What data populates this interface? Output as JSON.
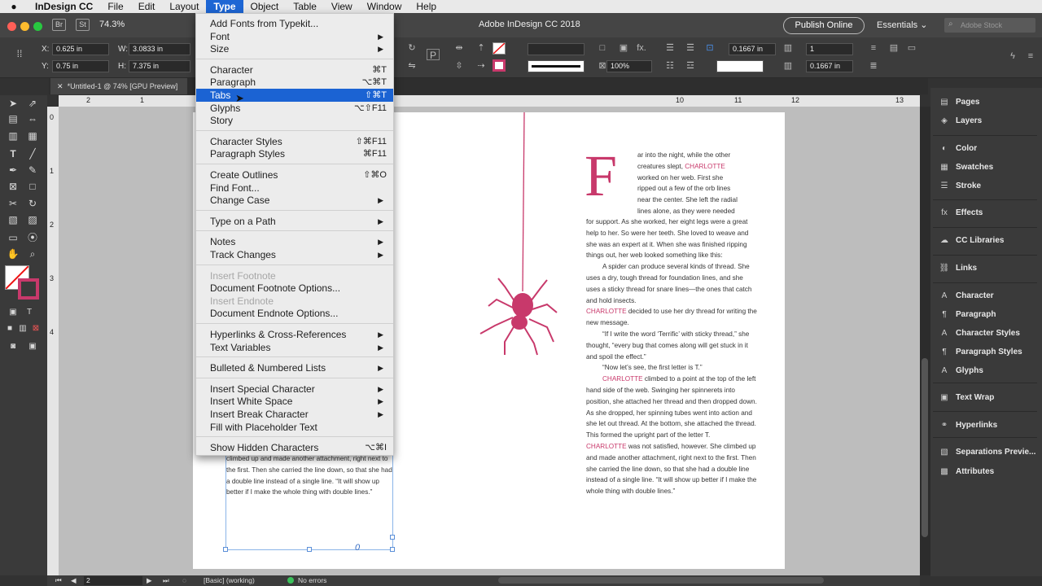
{
  "menubar": {
    "app": "InDesign CC",
    "items": [
      "File",
      "Edit",
      "Layout",
      "Type",
      "Object",
      "Table",
      "View",
      "Window",
      "Help"
    ]
  },
  "titlebar": {
    "zoom": "74.3%",
    "title": "Adobe InDesign CC 2018",
    "publish": "Publish Online",
    "workspace": "Essentials",
    "search_placeholder": "Adobe Stock",
    "app_icons": [
      "Br",
      "St"
    ]
  },
  "control": {
    "x_label": "X:",
    "x_value": "0.625 in",
    "y_label": "Y:",
    "y_value": "0.75 in",
    "w_label": "W:",
    "w_value": "3.0833 in",
    "h_label": "H:",
    "h_value": "7.375 in",
    "opacity": "100%",
    "offset1": "0.1667 in",
    "offset2": "0.1667 in",
    "columns": "1"
  },
  "doc_tab": "*Untitled-1 @ 74% [GPU Preview]",
  "ruler": {
    "h": [
      "2",
      "1",
      "10",
      "11",
      "12",
      "13"
    ],
    "v": [
      "0",
      "1",
      "2",
      "3",
      "4"
    ]
  },
  "type_menu": {
    "groups": [
      [
        {
          "label": "Add Fonts from Typekit...",
          "shortcut": "",
          "arrow": false,
          "disabled": false
        },
        {
          "label": "Font",
          "shortcut": "",
          "arrow": true,
          "disabled": false
        },
        {
          "label": "Size",
          "shortcut": "",
          "arrow": true,
          "disabled": false
        }
      ],
      [
        {
          "label": "Character",
          "shortcut": "⌘T",
          "arrow": false,
          "disabled": false
        },
        {
          "label": "Paragraph",
          "shortcut": "⌥⌘T",
          "arrow": false,
          "disabled": false
        },
        {
          "label": "Tabs",
          "shortcut": "⇧⌘T",
          "arrow": false,
          "disabled": false,
          "highlighted": true
        },
        {
          "label": "Glyphs",
          "shortcut": "⌥⇧F11",
          "arrow": false,
          "disabled": false
        },
        {
          "label": "Story",
          "shortcut": "",
          "arrow": false,
          "disabled": false
        }
      ],
      [
        {
          "label": "Character Styles",
          "shortcut": "⇧⌘F11",
          "arrow": false,
          "disabled": false
        },
        {
          "label": "Paragraph Styles",
          "shortcut": "⌘F11",
          "arrow": false,
          "disabled": false
        }
      ],
      [
        {
          "label": "Create Outlines",
          "shortcut": "⇧⌘O",
          "arrow": false,
          "disabled": false
        },
        {
          "label": "Find Font...",
          "shortcut": "",
          "arrow": false,
          "disabled": false
        },
        {
          "label": "Change Case",
          "shortcut": "",
          "arrow": true,
          "disabled": false
        }
      ],
      [
        {
          "label": "Type on a Path",
          "shortcut": "",
          "arrow": true,
          "disabled": false
        }
      ],
      [
        {
          "label": "Notes",
          "shortcut": "",
          "arrow": true,
          "disabled": false
        },
        {
          "label": "Track Changes",
          "shortcut": "",
          "arrow": true,
          "disabled": false
        }
      ],
      [
        {
          "label": "Insert Footnote",
          "shortcut": "",
          "arrow": false,
          "disabled": true
        },
        {
          "label": "Document Footnote Options...",
          "shortcut": "",
          "arrow": false,
          "disabled": false
        },
        {
          "label": "Insert Endnote",
          "shortcut": "",
          "arrow": false,
          "disabled": true
        },
        {
          "label": "Document Endnote Options...",
          "shortcut": "",
          "arrow": false,
          "disabled": false
        }
      ],
      [
        {
          "label": "Hyperlinks & Cross-References",
          "shortcut": "",
          "arrow": true,
          "disabled": false
        },
        {
          "label": "Text Variables",
          "shortcut": "",
          "arrow": true,
          "disabled": false
        }
      ],
      [
        {
          "label": "Bulleted & Numbered Lists",
          "shortcut": "",
          "arrow": true,
          "disabled": false
        }
      ],
      [
        {
          "label": "Insert Special Character",
          "shortcut": "",
          "arrow": true,
          "disabled": false
        },
        {
          "label": "Insert White Space",
          "shortcut": "",
          "arrow": true,
          "disabled": false
        },
        {
          "label": "Insert Break Character",
          "shortcut": "",
          "arrow": true,
          "disabled": false
        },
        {
          "label": "Fill with Placeholder Text",
          "shortcut": "",
          "arrow": false,
          "disabled": false
        }
      ],
      [
        {
          "label": "Show Hidden Characters",
          "shortcut": "⌥⌘I",
          "arrow": false,
          "disabled": false
        }
      ]
    ]
  },
  "panels": [
    {
      "label": "Pages",
      "icon": "▤",
      "name": "pages"
    },
    {
      "label": "Layers",
      "icon": "◈",
      "name": "layers"
    },
    {
      "label": "Color",
      "icon": "◐",
      "name": "color"
    },
    {
      "label": "Swatches",
      "icon": "▦",
      "name": "swatches"
    },
    {
      "label": "Stroke",
      "icon": "☰",
      "name": "stroke"
    },
    {
      "label": "Effects",
      "icon": "fx",
      "name": "effects"
    },
    {
      "label": "CC Libraries",
      "icon": "☁",
      "name": "cc-libraries"
    },
    {
      "label": "Links",
      "icon": "⛓",
      "name": "links"
    },
    {
      "label": "Character",
      "icon": "A",
      "name": "character"
    },
    {
      "label": "Paragraph",
      "icon": "¶",
      "name": "paragraph"
    },
    {
      "label": "Character Styles",
      "icon": "A",
      "name": "character-styles"
    },
    {
      "label": "Paragraph Styles",
      "icon": "¶",
      "name": "paragraph-styles"
    },
    {
      "label": "Glyphs",
      "icon": "A",
      "name": "glyphs"
    },
    {
      "label": "Text Wrap",
      "icon": "▣",
      "name": "text-wrap"
    },
    {
      "label": "Hyperlinks",
      "icon": "⚭",
      "name": "hyperlinks"
    },
    {
      "label": "Separations Previe...",
      "icon": "▧",
      "name": "separations-preview"
    },
    {
      "label": "Attributes",
      "icon": "▩",
      "name": "attributes"
    }
  ],
  "story": {
    "dropcap": "F",
    "wrap_lines": [
      "ar into the night, while the other",
      "creatures slept, ",
      "CHARLOTTE",
      "worked on her web. First she",
      "ripped out a few of the orb lines",
      "near the center. She left the radial",
      "lines alone, as they were needed"
    ],
    "para1_rest": "for support. As she worked, her eight legs were a great help to her. So were her teeth. She loved to weave and she was an expert at it. When she was finished ripping things out, her web looked something like this:",
    "para2": "A spider can produce several kinds of thread. She uses a dry, tough thread for foundation lines, and she uses a sticky thread for snare lines—the ones that catch and hold insects.",
    "name": "CHARLOTTE",
    "para2_rest": " decided to use her dry thread for writing the new message.",
    "para3": "“If I write the word ‘Terrific’ with sticky thread,” she thought, “every bug that comes along will get stuck in it and spoil the effect.”",
    "para4": "“Now let’s see, the first letter is T.”",
    "para5_rest": " climbed to a point at the top of the left hand side of the web. Swinging her spinnerets into position, she attached her thread and then dropped down. As she dropped, her spinning tubes went into action and she let out thread. At the bottom, she attached the thread. This formed the upright part of the letter T.",
    "para6_rest": " was not satisfied, however. She climbed up and made another attachment, right next to the first. Then she carried the line down, so that she had a double line instead of a single line. “It will show up better if I make the whole thing with double lines.”",
    "left_frame": "climbed up and made another attachment, right next to the first. Then she carried the line down, so that she had a double line instead of a single line. “It will show up better if I make the whole thing with double lines.”",
    "overflow_glyph": "0"
  },
  "status": {
    "page": "2",
    "style": "[Basic] (working)",
    "errors": "No errors"
  },
  "colors": {
    "accent": "#1b63d3",
    "spider": "#c8396b"
  }
}
